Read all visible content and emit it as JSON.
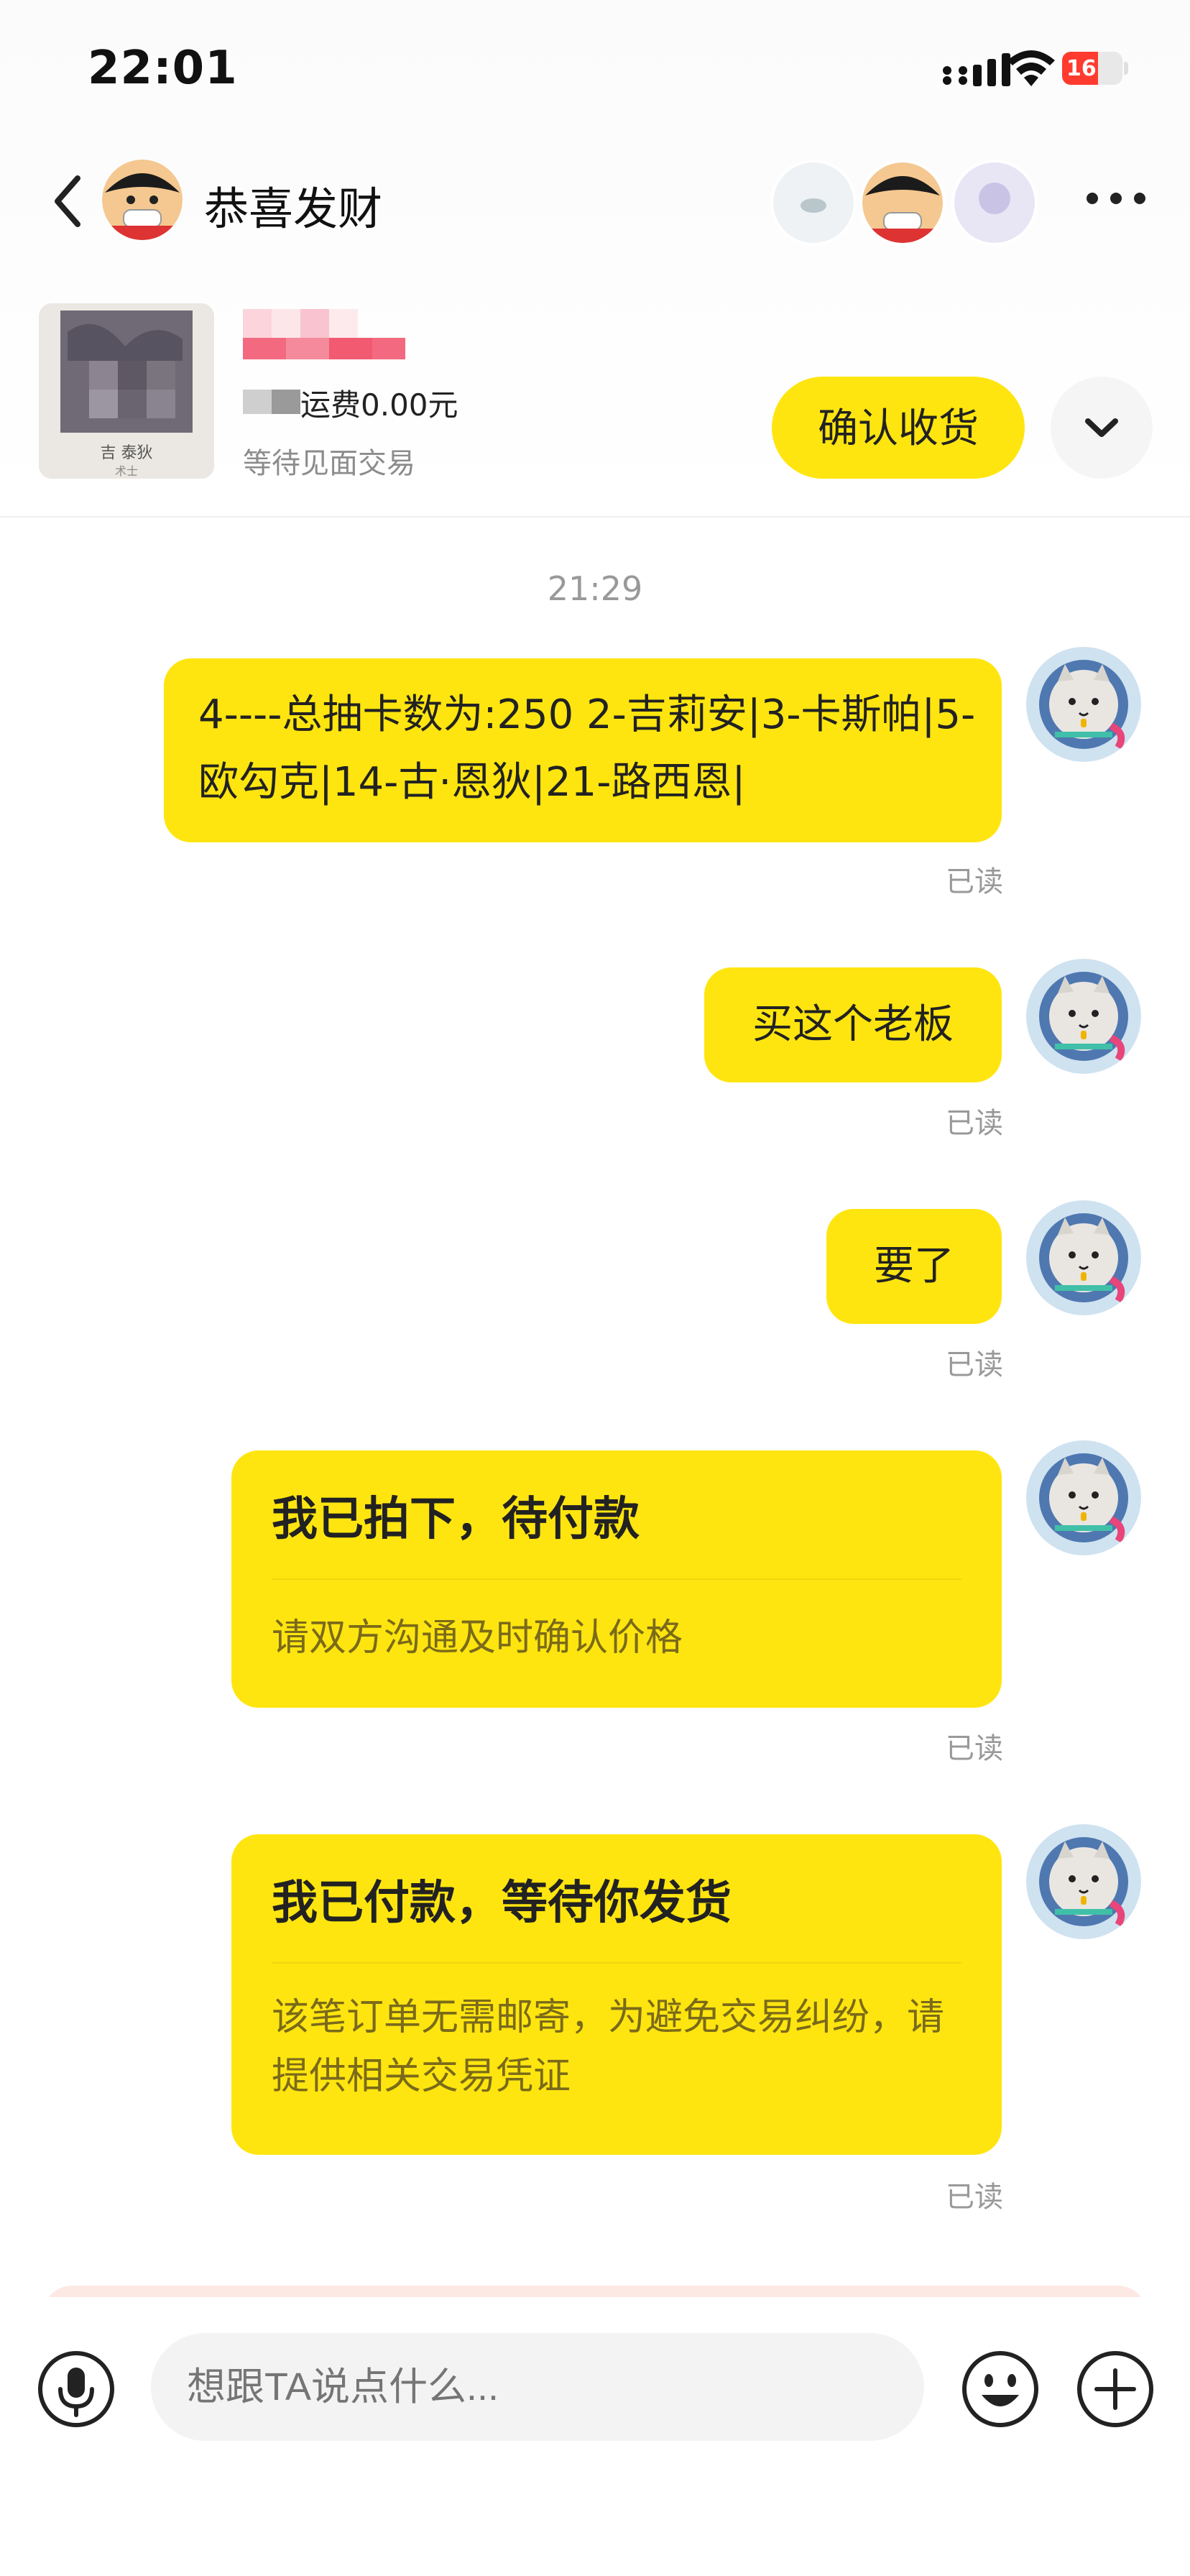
{
  "status_bar": {
    "time": "22:01",
    "battery_level": "16",
    "battery_percent": 16,
    "icons": [
      "signal-icon",
      "wifi-icon",
      "battery-icon"
    ]
  },
  "header": {
    "title": "恭喜发财",
    "icons": [
      "back-icon",
      "more-icon"
    ]
  },
  "product": {
    "price_text": "运费0.00元",
    "status": "等待见面交易",
    "thumb_label_1": "吉 泰狄",
    "thumb_label_2": "术士",
    "confirm_button": "确认收货",
    "expand_icon": "chevron-down-icon"
  },
  "chat": {
    "timestamp": "21:29",
    "messages": [
      {
        "text": "4----总抽卡数为:250 2-吉莉安|3-卡斯帕|5-欧勾克|14-古·恩狄|21-路西恩|",
        "read": "已读"
      },
      {
        "text": "买这个老板",
        "read": "已读"
      },
      {
        "text": "要了",
        "read": "已读"
      },
      {
        "title": "我已拍下，待付款",
        "body": "请双方沟通及时确认价格",
        "read": "已读"
      },
      {
        "title": "我已付款，等待你发货",
        "body": "该笔订单无需邮寄，为避免交易纠纷，请提供相关交易凭证",
        "read": "已读"
      }
    ]
  },
  "input_bar": {
    "placeholder": "想跟TA说点什么...",
    "icons": [
      "microphone-icon",
      "emoji-icon",
      "plus-icon"
    ]
  },
  "colors": {
    "accent": "#ffe50f",
    "read_text": "#999999",
    "battery_low": "#ff3b30"
  }
}
